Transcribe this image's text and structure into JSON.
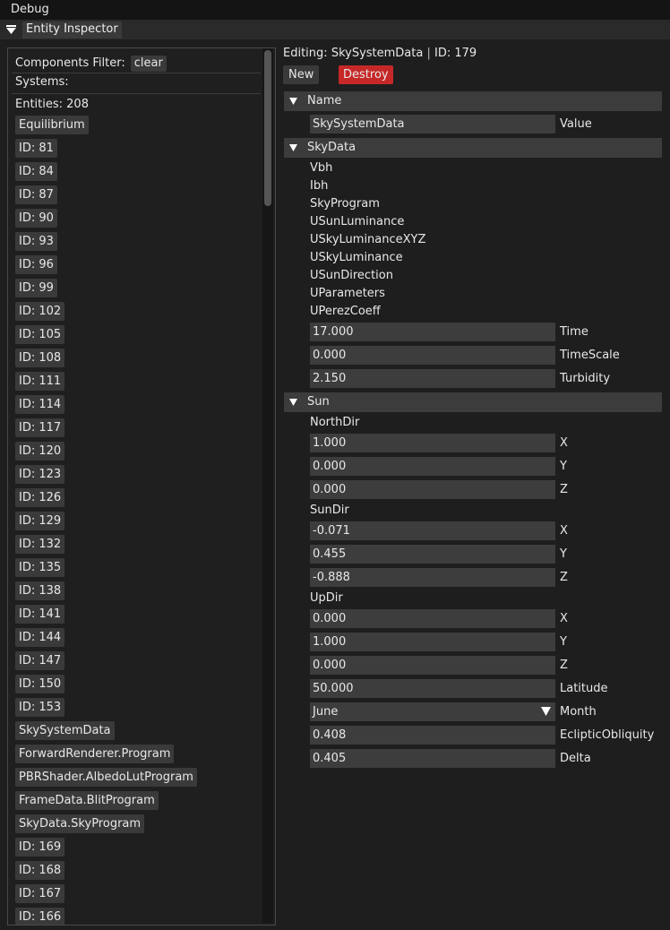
{
  "menubar": {
    "title": "Debug"
  },
  "window": {
    "title": "Entity Inspector"
  },
  "left": {
    "filter_label": "Components Filter:",
    "clear_label": "clear",
    "systems_label": "Systems:",
    "entities_label": "Entities: 208",
    "entities": [
      "Equilibrium",
      "ID: 81",
      "ID: 84",
      "ID: 87",
      "ID: 90",
      "ID: 93",
      "ID: 96",
      "ID: 99",
      "ID: 102",
      "ID: 105",
      "ID: 108",
      "ID: 111",
      "ID: 114",
      "ID: 117",
      "ID: 120",
      "ID: 123",
      "ID: 126",
      "ID: 129",
      "ID: 132",
      "ID: 135",
      "ID: 138",
      "ID: 141",
      "ID: 144",
      "ID: 147",
      "ID: 150",
      "ID: 153",
      "SkySystemData",
      "ForwardRenderer.Program",
      "PBRShader.AlbedoLutProgram",
      "FrameData.BlitProgram",
      "SkyData.SkyProgram",
      "ID: 169",
      "ID: 168",
      "ID: 167",
      "ID: 166"
    ]
  },
  "editor": {
    "editing_prefix": "Editing:",
    "editing_name": "SkySystemData",
    "editing_id": "ID: 179",
    "new_label": "New",
    "destroy_label": "Destroy",
    "name_section": {
      "title": "Name",
      "value": "SkySystemData",
      "value_label": "Value"
    },
    "skydata_section": {
      "title": "SkyData",
      "items": [
        "Vbh",
        "Ibh",
        "SkyProgram",
        "USunLuminance",
        "USkyLuminanceXYZ",
        "USkyLuminance",
        "USunDirection",
        "UParameters",
        "UPerezCoeff"
      ],
      "time": {
        "value": "17.000",
        "label": "Time"
      },
      "timescale": {
        "value": "0.000",
        "label": "TimeScale"
      },
      "turbidity": {
        "value": "2.150",
        "label": "Turbidity"
      }
    },
    "sun_section": {
      "title": "Sun",
      "northdir": {
        "label": "NorthDir",
        "x": "1.000",
        "y": "0.000",
        "z": "0.000"
      },
      "sundir": {
        "label": "SunDir",
        "x": "-0.071",
        "y": "0.455",
        "z": "-0.888"
      },
      "updir": {
        "label": "UpDir",
        "x": "0.000",
        "y": "1.000",
        "z": "0.000"
      },
      "axis_x": "X",
      "axis_y": "Y",
      "axis_z": "Z",
      "latitude": {
        "value": "50.000",
        "label": "Latitude"
      },
      "month": {
        "value": "June",
        "label": "Month"
      },
      "ecliptic": {
        "value": "0.408",
        "label": "EclipticObliquity"
      },
      "delta": {
        "value": "0.405",
        "label": "Delta"
      }
    }
  },
  "colors": {
    "destroy": "#c62828",
    "button": "#3a3a3a",
    "section_header": "#3c3c3c",
    "field_bg": "#3d3d3d"
  }
}
